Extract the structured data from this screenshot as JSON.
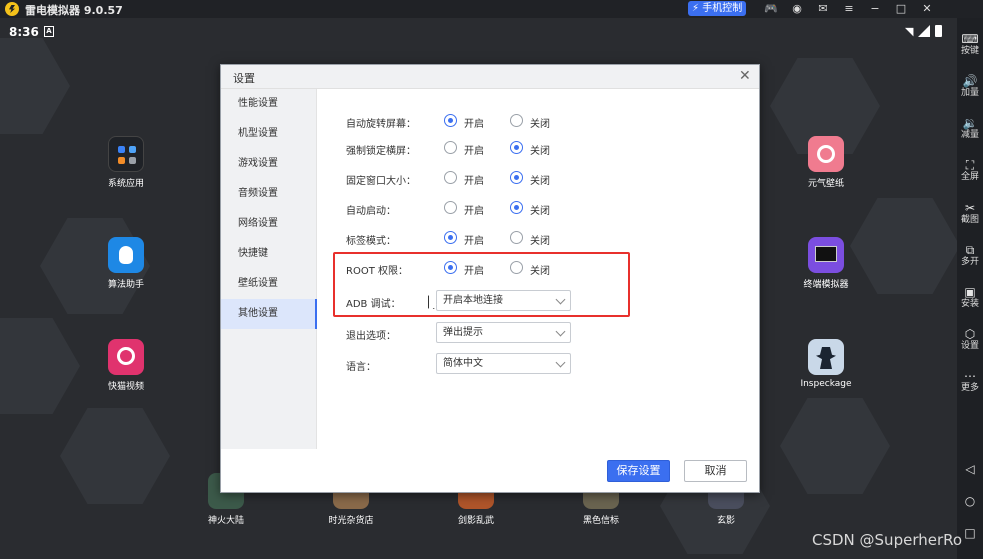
{
  "titlebar": {
    "app_title": "雷电模拟器 9.0.57",
    "phone_control": "手机控制",
    "icons": [
      "gamepad-icon",
      "user-icon",
      "mail-icon",
      "menu-icon",
      "minimize-icon",
      "maximize-icon",
      "close-icon"
    ],
    "icon_glyphs": [
      "🎮",
      "◉",
      "✉",
      "≡",
      "−",
      "□",
      "✕"
    ]
  },
  "statusbar": {
    "time": "8:36",
    "a_badge": "A"
  },
  "desktop_apps": {
    "system_apps": "系统应用",
    "suanfa": "算法助手",
    "kuaimao": "快猫视频",
    "yuanqi": "元气壁纸",
    "terminal": "终端模拟器",
    "inspeckage": "Inspeckage",
    "shenhuo": "神火大陆",
    "shiguang": "时光杂货店",
    "jianying": "剑影乱武",
    "heise": "黑色信标",
    "xuanying": "玄影"
  },
  "rightbar": {
    "items": [
      {
        "label": "按键",
        "icon": "keyboard-icon",
        "glyph": "⌨"
      },
      {
        "label": "加量",
        "icon": "volume-up-icon",
        "glyph": "🔊"
      },
      {
        "label": "减量",
        "icon": "volume-down-icon",
        "glyph": "🔉"
      },
      {
        "label": "全屏",
        "icon": "fullscreen-icon",
        "glyph": "⛶"
      },
      {
        "label": "截图",
        "icon": "scissors-icon",
        "glyph": "✂"
      },
      {
        "label": "多开",
        "icon": "multi-instance-icon",
        "glyph": "⧉"
      },
      {
        "label": "安装",
        "icon": "apk-install-icon",
        "glyph": "▣"
      },
      {
        "label": "设置",
        "icon": "settings-icon",
        "glyph": "⬡"
      },
      {
        "label": "更多",
        "icon": "more-icon",
        "glyph": "⋯"
      }
    ],
    "nav": {
      "back": "◁",
      "home": "○",
      "recent": "□"
    }
  },
  "dialog": {
    "title": "设置",
    "close": "✕",
    "sidebar": [
      "性能设置",
      "机型设置",
      "游戏设置",
      "音频设置",
      "网络设置",
      "快捷键",
      "壁纸设置",
      "其他设置"
    ],
    "active_tab": "其他设置",
    "options": {
      "on": "开启",
      "off": "关闭"
    },
    "radio_rows": [
      {
        "label": "自动旋转屏幕：",
        "value": "开启"
      },
      {
        "label": "强制锁定横屏：",
        "value": "关闭"
      },
      {
        "label": "固定窗口大小：",
        "value": "关闭"
      },
      {
        "label": "自动启动：",
        "value": "关闭"
      },
      {
        "label": "标签模式：",
        "value": "开启"
      },
      {
        "label": "ROOT 权限：",
        "value": "开启"
      }
    ],
    "adb": {
      "label": "ADB 调试：",
      "value": "开启本地连接"
    },
    "exit": {
      "label": "退出选项：",
      "value": "弹出提示"
    },
    "language": {
      "label": "语言：",
      "value": "简体中文"
    },
    "save": "保存设置",
    "cancel": "取消"
  },
  "watermark": "CSDN @SuperherRo",
  "colors": {
    "accent": "#3b6ff0",
    "highlight": "#e8302c"
  }
}
